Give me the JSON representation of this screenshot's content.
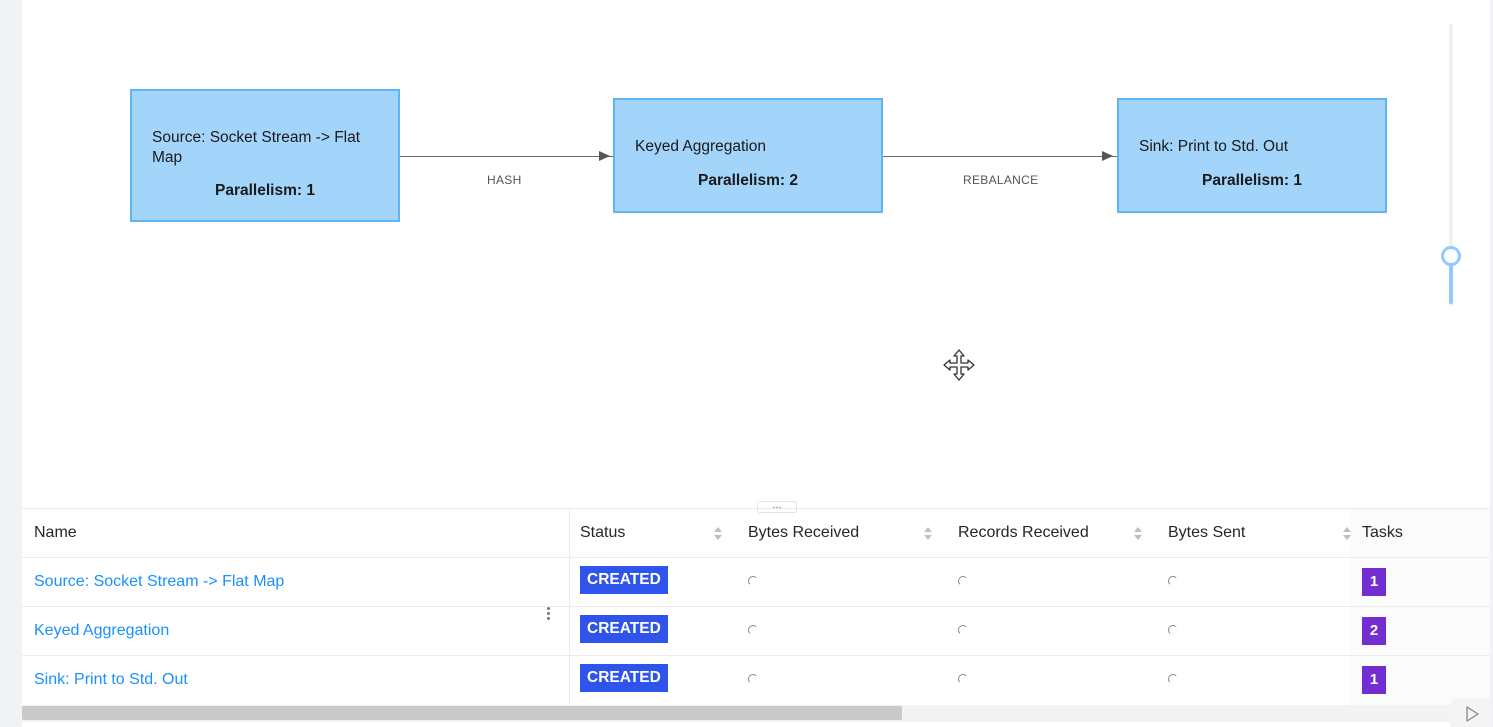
{
  "graph": {
    "nodes": [
      {
        "title": "Source: Socket Stream -> Flat Map",
        "parallelism": "Parallelism: 1"
      },
      {
        "title": "Keyed Aggregation",
        "parallelism": "Parallelism: 2"
      },
      {
        "title": "Sink: Print to Std. Out",
        "parallelism": "Parallelism: 1"
      }
    ],
    "edges": [
      {
        "label": "HASH"
      },
      {
        "label": "REBALANCE"
      }
    ]
  },
  "table": {
    "headers": {
      "name": "Name",
      "status": "Status",
      "bytes_received": "Bytes Received",
      "records_received": "Records Received",
      "bytes_sent": "Bytes Sent",
      "tasks": "Tasks"
    },
    "rows": [
      {
        "name": "Source: Socket Stream -> Flat Map",
        "status": "CREATED",
        "tasks": "1"
      },
      {
        "name": "Keyed Aggregation",
        "status": "CREATED",
        "tasks": "2"
      },
      {
        "name": "Sink: Print to Std. Out",
        "status": "CREATED",
        "tasks": "1"
      }
    ]
  },
  "split_handle": "...",
  "colors": {
    "node_fill": "#a3d5fb",
    "node_border": "#5fb4f3",
    "status_created": "#2f54eb",
    "task_badge": "#722ed1",
    "link": "#1890ff"
  },
  "icons": [
    "move-cursor-icon",
    "loading-spinner-icon",
    "sort-icon",
    "play-icon"
  ]
}
